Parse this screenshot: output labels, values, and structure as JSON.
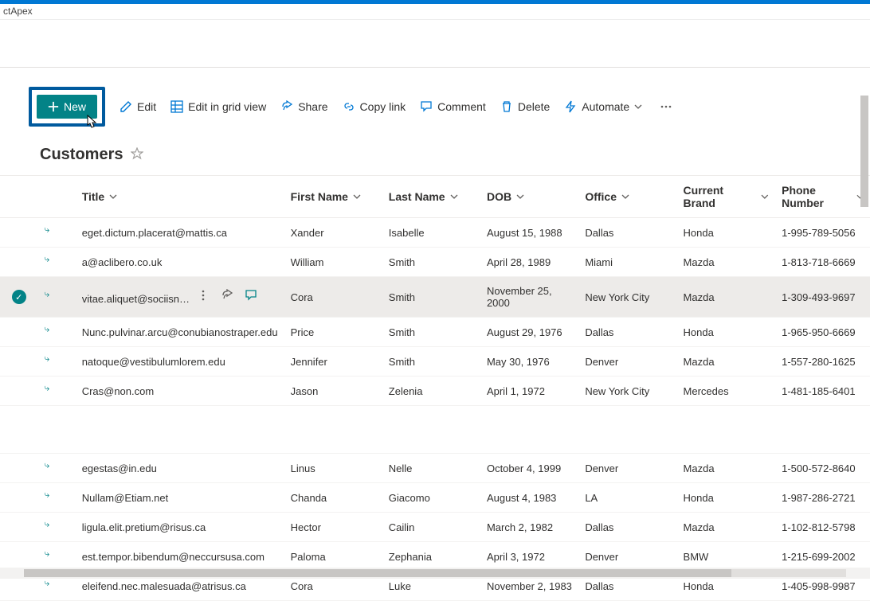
{
  "breadcrumb": "ctApex",
  "toolbar": {
    "new": "New",
    "edit": "Edit",
    "edit_grid": "Edit in grid view",
    "share": "Share",
    "copy_link": "Copy link",
    "comment": "Comment",
    "delete": "Delete",
    "automate": "Automate"
  },
  "list": {
    "title": "Customers"
  },
  "columns": {
    "title": "Title",
    "first_name": "First Name",
    "last_name": "Last Name",
    "dob": "DOB",
    "office": "Office",
    "brand": "Current Brand",
    "phone": "Phone Number"
  },
  "selected_index": 2,
  "rows": [
    {
      "title": "eget.dictum.placerat@mattis.ca",
      "first": "Xander",
      "last": "Isabelle",
      "dob": "August 15, 1988",
      "office": "Dallas",
      "brand": "Honda",
      "phone": "1-995-789-5056"
    },
    {
      "title": "a@aclibero.co.uk",
      "first": "William",
      "last": "Smith",
      "dob": "April 28, 1989",
      "office": "Miami",
      "brand": "Mazda",
      "phone": "1-813-718-6669"
    },
    {
      "title": "vitae.aliquet@sociisnato…",
      "first": "Cora",
      "last": "Smith",
      "dob": "November 25, 2000",
      "office": "New York City",
      "brand": "Mazda",
      "phone": "1-309-493-9697"
    },
    {
      "title": "Nunc.pulvinar.arcu@conubianostraper.edu",
      "first": "Price",
      "last": "Smith",
      "dob": "August 29, 1976",
      "office": "Dallas",
      "brand": "Honda",
      "phone": "1-965-950-6669"
    },
    {
      "title": "natoque@vestibulumlorem.edu",
      "first": "Jennifer",
      "last": "Smith",
      "dob": "May 30, 1976",
      "office": "Denver",
      "brand": "Mazda",
      "phone": "1-557-280-1625"
    },
    {
      "title": "Cras@non.com",
      "first": "Jason",
      "last": "Zelenia",
      "dob": "April 1, 1972",
      "office": "New York City",
      "brand": "Mercedes",
      "phone": "1-481-185-6401"
    }
  ],
  "rows2": [
    {
      "title": "egestas@in.edu",
      "first": "Linus",
      "last": "Nelle",
      "dob": "October 4, 1999",
      "office": "Denver",
      "brand": "Mazda",
      "phone": "1-500-572-8640"
    },
    {
      "title": "Nullam@Etiam.net",
      "first": "Chanda",
      "last": "Giacomo",
      "dob": "August 4, 1983",
      "office": "LA",
      "brand": "Honda",
      "phone": "1-987-286-2721"
    },
    {
      "title": "ligula.elit.pretium@risus.ca",
      "first": "Hector",
      "last": "Cailin",
      "dob": "March 2, 1982",
      "office": "Dallas",
      "brand": "Mazda",
      "phone": "1-102-812-5798"
    },
    {
      "title": "est.tempor.bibendum@neccursusa.com",
      "first": "Paloma",
      "last": "Zephania",
      "dob": "April 3, 1972",
      "office": "Denver",
      "brand": "BMW",
      "phone": "1-215-699-2002"
    },
    {
      "title": "eleifend.nec.malesuada@atrisus.ca",
      "first": "Cora",
      "last": "Luke",
      "dob": "November 2, 1983",
      "office": "Dallas",
      "brand": "Honda",
      "phone": "1-405-998-9987"
    }
  ]
}
